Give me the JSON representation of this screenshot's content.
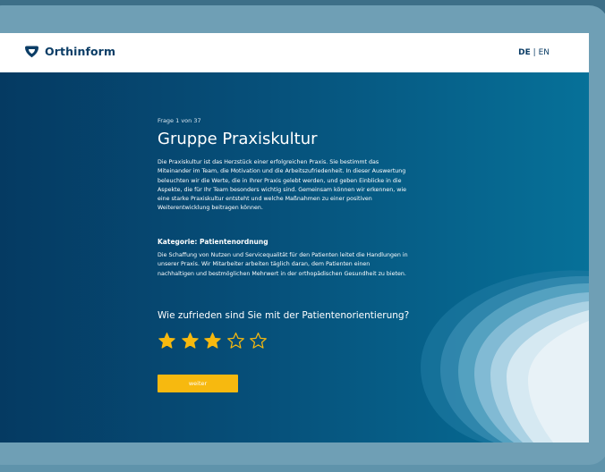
{
  "brand": {
    "name": "Orthinform",
    "logo_icon": "heart-shield-icon",
    "color": "#0b3d66"
  },
  "language": {
    "active": "DE",
    "separator": "|",
    "other": "EN"
  },
  "survey": {
    "progress": "Frage 1 von 37",
    "title": "Gruppe Praxiskultur",
    "intro": "Die Praxiskultur ist das Herzstück einer erfolgreichen Praxis. Sie bestimmt das Miteinander im Team, die Motivation und die Arbeitszufriedenheit. In dieser Auswertung beleuchten wir die Werte, die in Ihrer Praxis gelebt werden, und geben Einblicke in die Aspekte, die für Ihr Team besonders wichtig sind. Gemeinsam können wir erkennen, wie eine starke Praxiskultur entsteht und welche Maßnahmen zu einer positiven Weiterentwicklung beitragen können.",
    "category_title": "Kategorie: Patientenordnung",
    "category_text": "Die Schaffung von Nutzen und Servicequalität für den Patienten leitet die Handlungen in unserer Praxis. Wir Mitarbeiter arbeiten täglich daran, dem Patienten einen nachhaltigen und bestmöglichen Mehrwert in der orthopädischen Gesundheit zu bieten.",
    "question": "Wie zufrieden sind Sie mit der Patientenorientierung?",
    "rating": {
      "value": 3,
      "max": 5,
      "filled_color": "#f7b90f",
      "empty_color": "#f7b90f"
    },
    "next_label": "weiter",
    "accent_color": "#f7b90f"
  },
  "colors": {
    "hero_dark": "#053a62",
    "hero_light": "#067199",
    "frame": "#6f9fb5"
  }
}
